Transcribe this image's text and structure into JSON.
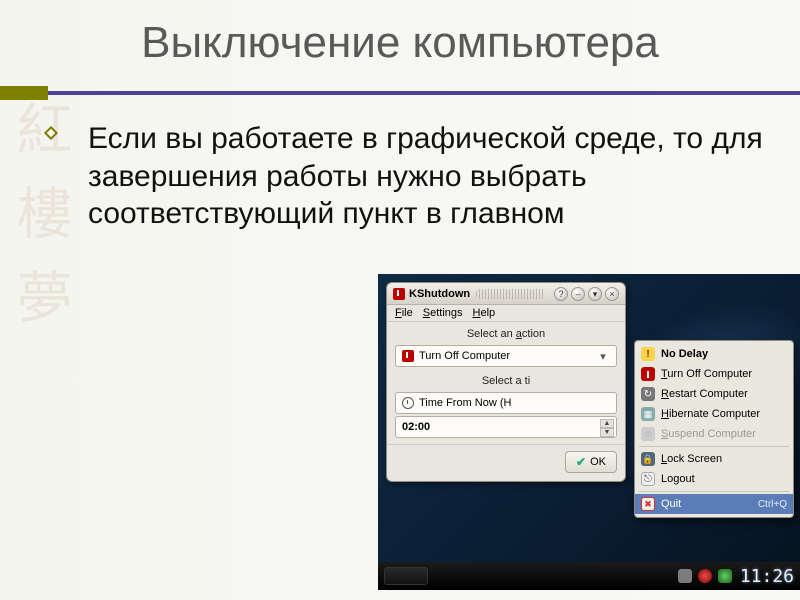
{
  "slide": {
    "title": "Выключение компьютера",
    "body": "Если вы работаете в графической среде, то для завершения работы нужно выбрать соответствующий пункт в главном",
    "watermark": "紅樓夢"
  },
  "kshutdown": {
    "title": "KShutdown",
    "menubar": {
      "file": "File",
      "settings": "Settings",
      "help": "Help"
    },
    "section_action": "Select an action",
    "action_value": "Turn Off Computer",
    "section_time": "Select a ti",
    "time_mode": "Time From Now (H",
    "time_value": "02:00",
    "ok": "OK"
  },
  "menu": {
    "items": [
      {
        "label": "No Delay",
        "icon": "warn",
        "bold": true
      },
      {
        "label": "Turn Off Computer",
        "icon": "power",
        "u": 0
      },
      {
        "label": "Restart Computer",
        "icon": "restart",
        "u": 0
      },
      {
        "label": "Hibernate Computer",
        "icon": "hib",
        "u": 0
      },
      {
        "label": "Suspend Computer",
        "icon": "susp",
        "u": 0,
        "dim": true
      },
      {
        "label": "Lock Screen",
        "icon": "lock",
        "u": 0
      },
      {
        "label": "Logout",
        "icon": "logout"
      },
      {
        "label": "Quit",
        "icon": "quit",
        "shortcut": "Ctrl+Q",
        "sel": true
      }
    ]
  },
  "taskbar": {
    "clock": "11:26"
  }
}
